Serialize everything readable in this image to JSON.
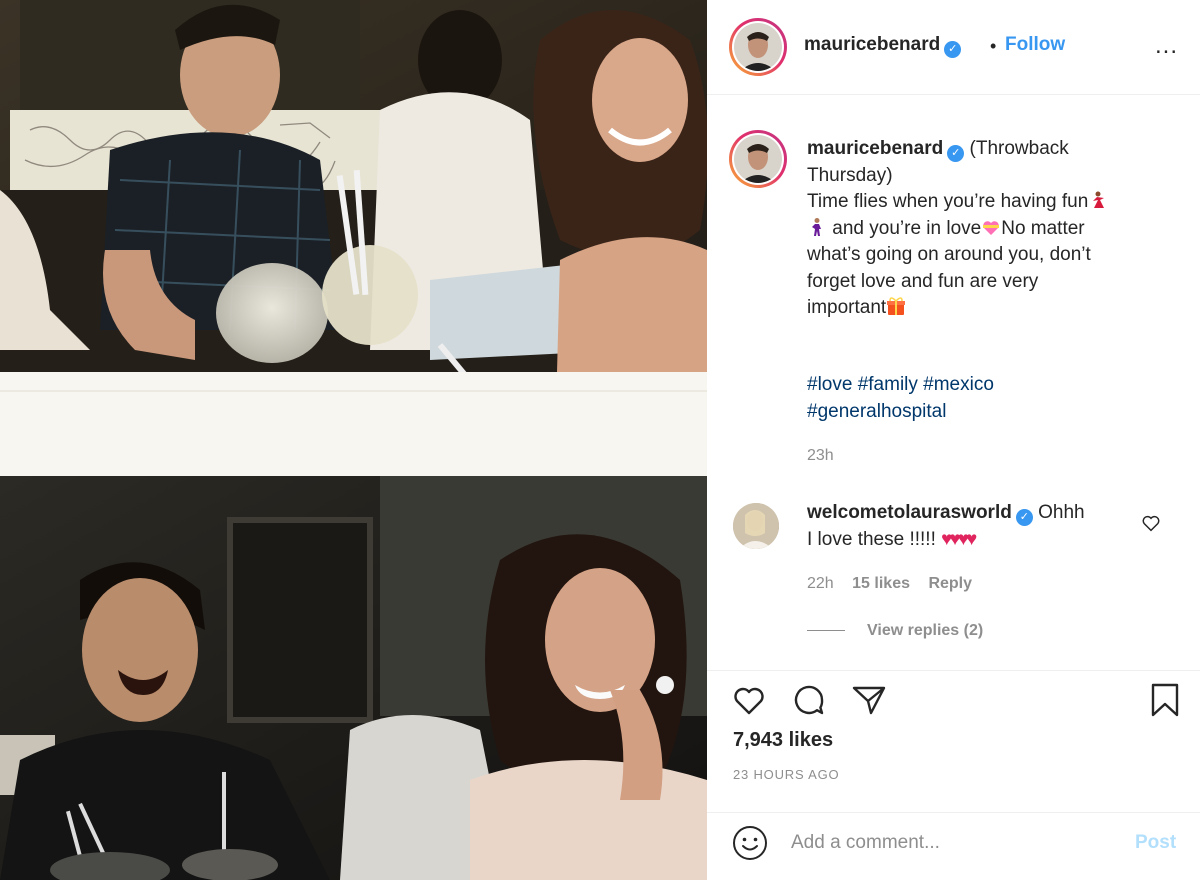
{
  "post": {
    "username": "mauricebenard",
    "follow_label": "Follow",
    "more_label": "...",
    "caption_lines": [
      "(Throwback",
      "Thursday)",
      "Time flies when you’re having fun",
      "and you’re in love",
      "No matter",
      "what’s going on around you, don’t",
      "forget love and fun are very",
      "important"
    ],
    "hashtags_line1": "#love #family #mexico",
    "hashtags_line2": "#generalhospital",
    "caption_time": "23h",
    "comment": {
      "username": "welcometolaurasworld",
      "text_first": "Ohhh",
      "text_second": "I love these !!!!!",
      "time": "22h",
      "likes": "15 likes",
      "reply": "Reply",
      "view_replies": "View replies (2)"
    },
    "likes_count": "7,943 likes",
    "post_age": "23 HOURS AGO",
    "add_comment_placeholder": "Add a comment...",
    "post_button": "Post"
  },
  "icons": {
    "verified": "verified-badge-icon",
    "like": "heart-icon",
    "comment": "comment-bubble-icon",
    "share": "paper-plane-icon",
    "save": "bookmark-icon",
    "emoji": "smiley-icon"
  },
  "colors": {
    "link": "#3897f0",
    "hashtag": "#00376b",
    "muted": "#8e8e8e",
    "post_disabled": "#b2dffc"
  }
}
